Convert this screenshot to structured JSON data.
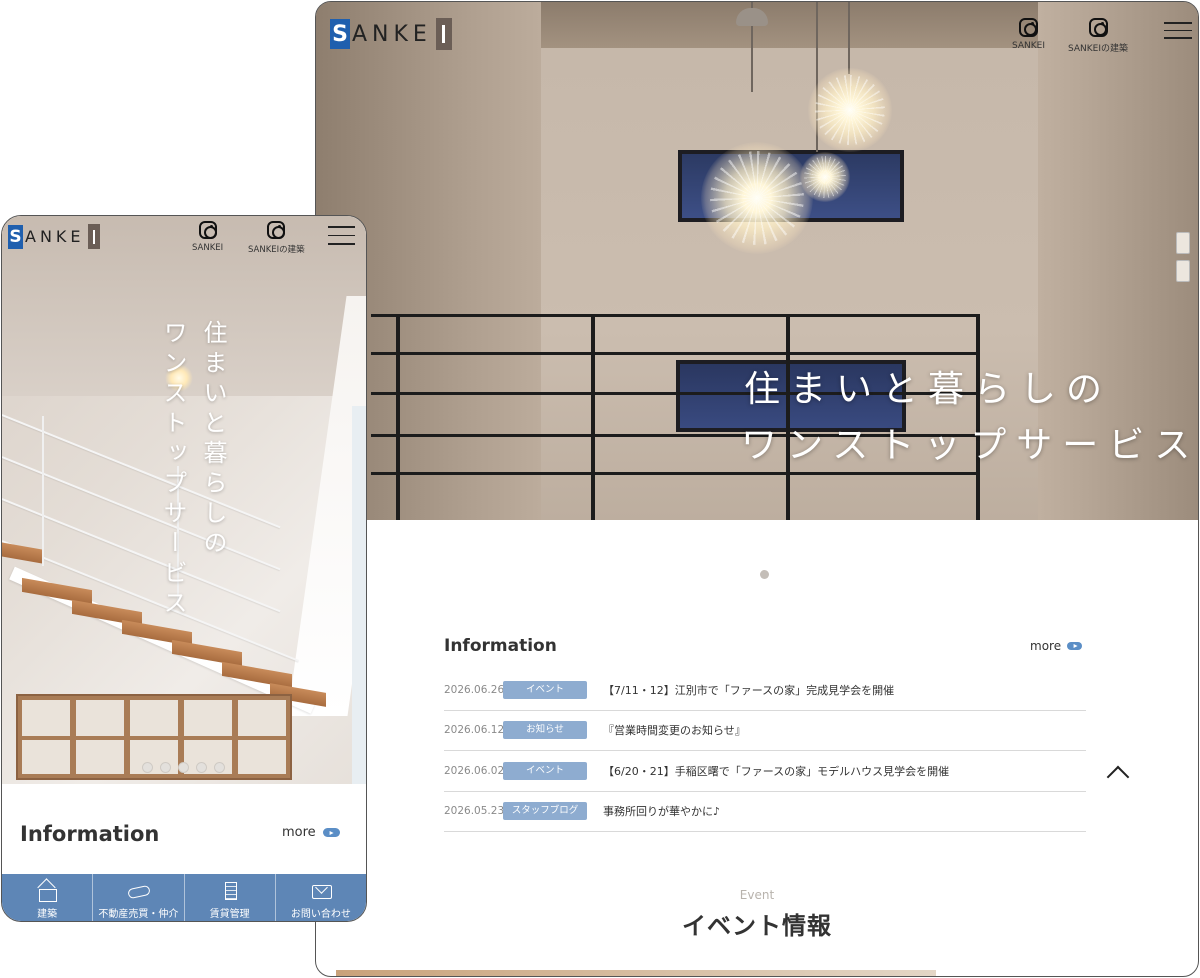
{
  "brand": {
    "logo_letter": "S",
    "logo_word": "ANKE",
    "logo_alt": "SANKEI"
  },
  "header": {
    "instagram_1": "SANKEI",
    "instagram_2": "SANKEIの建築"
  },
  "hero": {
    "catch_line1": "住まいと暮らしの",
    "catch_line2": "ワンストップサービス"
  },
  "information": {
    "title": "Information",
    "more_label": "more",
    "items": [
      {
        "date": "2026.06.26",
        "category": "イベント",
        "text": "【7/11・12】江別市で「ファースの家」完成見学会を開催"
      },
      {
        "date": "2026.06.12",
        "category": "お知らせ",
        "text": "『営業時間変更のお知らせ』"
      },
      {
        "date": "2026.06.02",
        "category": "イベント",
        "text": "【6/20・21】手稲区曙で「ファースの家」モデルハウス見学会を開催"
      },
      {
        "date": "2026.05.23",
        "category": "スタッフブログ",
        "text": "事務所回りが華やかに♪"
      }
    ]
  },
  "event": {
    "label_en": "Event",
    "title": "イベント情報"
  },
  "mobile_nav": [
    {
      "label": "建築",
      "icon": "house-icon"
    },
    {
      "label": "不動産売買・仲介",
      "icon": "handshake-icon"
    },
    {
      "label": "賃貸管理",
      "icon": "building-icon"
    },
    {
      "label": "お問い合わせ",
      "icon": "mail-icon"
    }
  ],
  "colors": {
    "brand_blue": "#1f5fae",
    "category_badge": "#8eacd0",
    "nav_bar": "#5e86b6",
    "more_pill": "#5b8ec6"
  }
}
